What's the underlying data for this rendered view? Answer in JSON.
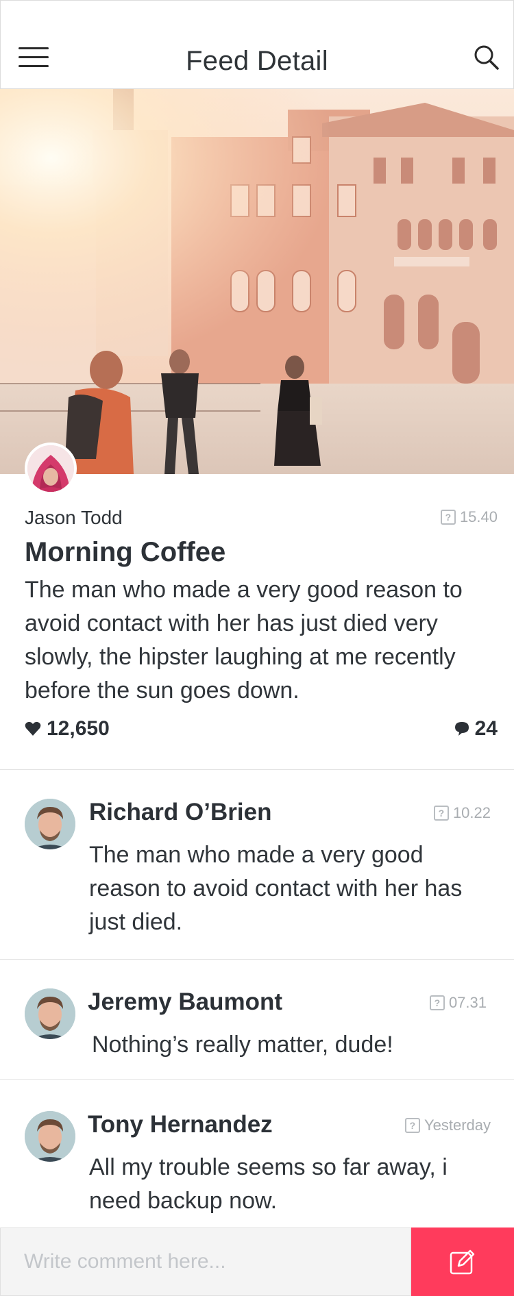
{
  "header": {
    "title": "Feed Detail"
  },
  "post": {
    "author": "Jason Todd",
    "time": "15.40",
    "title": "Morning Coffee",
    "body": "The man who made a very good reason to avoid contact with her has just died very slowly, the hipster laughing at me recently before the sun goes down.",
    "likes": "12,650",
    "comments": "24"
  },
  "comments": [
    {
      "name": "Richard O’Brien",
      "time": "10.22",
      "text": "The man who made a very good reason to avoid contact with her has just died."
    },
    {
      "name": "Jeremy Baumont",
      "time": "07.31",
      "text": "Nothing’s really matter, dude!"
    },
    {
      "name": "Tony Hernandez",
      "time": "Yesterday",
      "text": "All my trouble seems so far away, i need backup now."
    }
  ],
  "composer": {
    "placeholder": "Write comment here..."
  },
  "colors": {
    "accent": "#ff3b5c",
    "text": "#2c3137",
    "muted": "#a9adb1"
  },
  "icons": {
    "menu": "hamburger-icon",
    "search": "search-icon",
    "like": "heart-icon",
    "comment": "speech-bubble-icon",
    "time": "clock-icon",
    "send": "edit-icon"
  }
}
